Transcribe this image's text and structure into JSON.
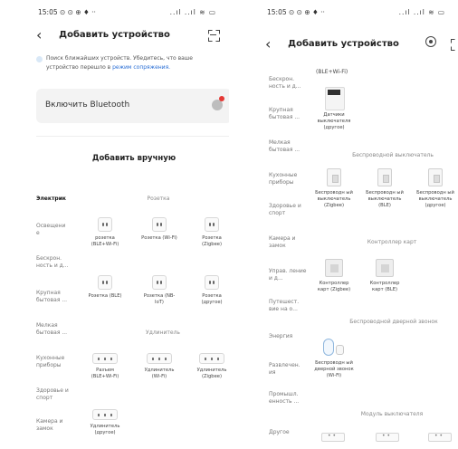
{
  "left": {
    "status": {
      "time": "15:05 ⊙ ⊙ ⊕ ♦ ··",
      "sys": "..ıl ..ıl ≋ ▭"
    },
    "title": "Добавить устройство",
    "notice_text": "Поиск ближайших устройств. Убедитесь, что ваше устройство перешло в",
    "notice_link": "режим сопряжения.",
    "bluetooth_label": "Включить Bluetooth",
    "manual_title": "Добавить вручную",
    "sidebar": [
      "Электрик",
      "Освещени е",
      "Бескрон. ность и д...",
      "Крупная бытовая ...",
      "Мелкая бытовая ...",
      "Кухонные приборы",
      "Здоровье и спорт",
      "Камера и замок"
    ],
    "sections": {
      "socket": "Розетка",
      "extender": "Удлинитель"
    },
    "devices": [
      {
        "label": "розетка (BLE+Wi-Fi)"
      },
      {
        "label": "Розетка (Wi-Fi)"
      },
      {
        "label": "Розетка (Zigbee)"
      },
      {
        "label": "Розетка (BLE)"
      },
      {
        "label": "Розетка (NB-IoT)"
      },
      {
        "label": "Розетка (другое)"
      },
      {
        "label": "Разъем (BLE+Wi-Fi)"
      },
      {
        "label": "Удлинитель (Wi-Fi)"
      },
      {
        "label": "Удлинитель (Zigbee)"
      },
      {
        "label": "Удлинитель (другое)"
      }
    ]
  },
  "right": {
    "status": {
      "time": "15:05 ⊙ ⊙ ⊕ ♦ ··",
      "sys": "..ıl ..ıl ≋ ▭"
    },
    "title": "Добавить устройство",
    "sidebar": [
      "Бескрон. ность и д...",
      "Крупная бытовая ...",
      "Мелкая бытовая ...",
      "Кухонные приборы",
      "Здоровье и спорт",
      "Камера и замок",
      "Управ. ление и д...",
      "Путешест. вие на о...",
      "Энергия",
      "Развлечен. ия",
      "Промышл. енность ...",
      "Другое"
    ],
    "top_caption": "(BLE+Wi-Fi)",
    "hub_label": "Датчики выключателя (другое)",
    "sections": {
      "wireless_switch": "Беспроводной выключатель",
      "scene": "Контроллер карт",
      "doorbell": "Беспроводной дверной звонок",
      "switch_module": "Модуль выключателя"
    },
    "wireless_devices": [
      {
        "label": "Беспроводн ый выключатель (Zigbee)"
      },
      {
        "label": "Беспроводн ый выключатель (BLE)"
      },
      {
        "label": "Беспроводн ый выключатель (другое)"
      }
    ],
    "scene_devices": [
      {
        "label": "Контроллер карт (Zigbee)"
      },
      {
        "label": "Контроллер карт (BLE)"
      }
    ],
    "doorbell_devices": [
      {
        "label": "Беспроводн ый дверной звонок (Wi-Fi)"
      }
    ]
  }
}
